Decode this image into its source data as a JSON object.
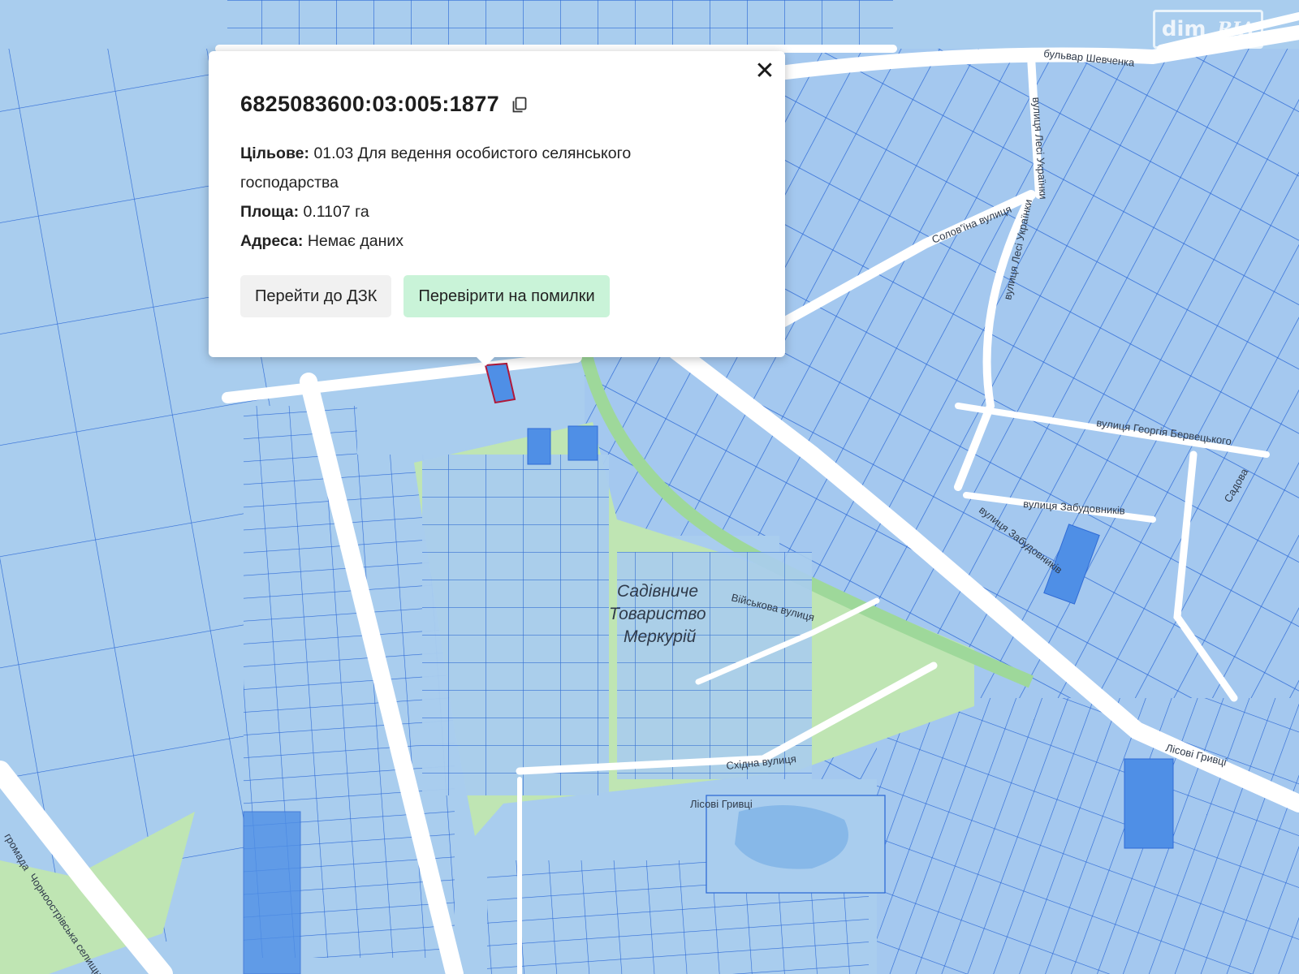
{
  "watermark": {
    "dim": "dim",
    "ria": "RIA"
  },
  "popup": {
    "cadastral_number": "6825083600:03:005:1877",
    "purpose_label": "Цільове:",
    "purpose_value": "01.03 Для ведення особистого селянського господарства",
    "area_label": "Площа:",
    "area_value": "0.1107 га",
    "address_label": "Адреса:",
    "address_value": "Немає даних",
    "btn_dzk": "Перейти до ДЗК",
    "btn_check": "Перевірити на помилки",
    "close": "✕"
  },
  "map": {
    "labels": {
      "blvd_shevchenka": "бульвар Шевченка",
      "lesi_ukrainky_1": "вулиця Лесі Українки",
      "lesi_ukrainky_2": "вулиця Лесі Українки",
      "solovyina": "Солов'їна вулиця",
      "heorhiia": "вулиця Георгія Бервецького",
      "zabudovnykiv": "вулиця Забудовників",
      "zabudovnykiv_2": "вулиця Забудовників",
      "sadova": "Садова",
      "viiskova": "Військова вулиця",
      "skhidna": "Східна вулиця",
      "lisovi_1": "Лісові Гривці",
      "lisovi_2": "Лісові Гривці",
      "garden_1": "Садівниче",
      "garden_2": "Товариство",
      "garden_3": "Меркурій",
      "hromada": "громада",
      "chornoostriv": "Чорноострівська селищна г"
    },
    "colors": {
      "parcel_fill": "#a9cdee",
      "parcel_stroke": "#2f6bd6",
      "road": "#ffffff",
      "green": "#bfe5b3",
      "highlight": "#4f8fe6",
      "selected_outline": "#b0193a",
      "water": "#87b8e8"
    }
  }
}
